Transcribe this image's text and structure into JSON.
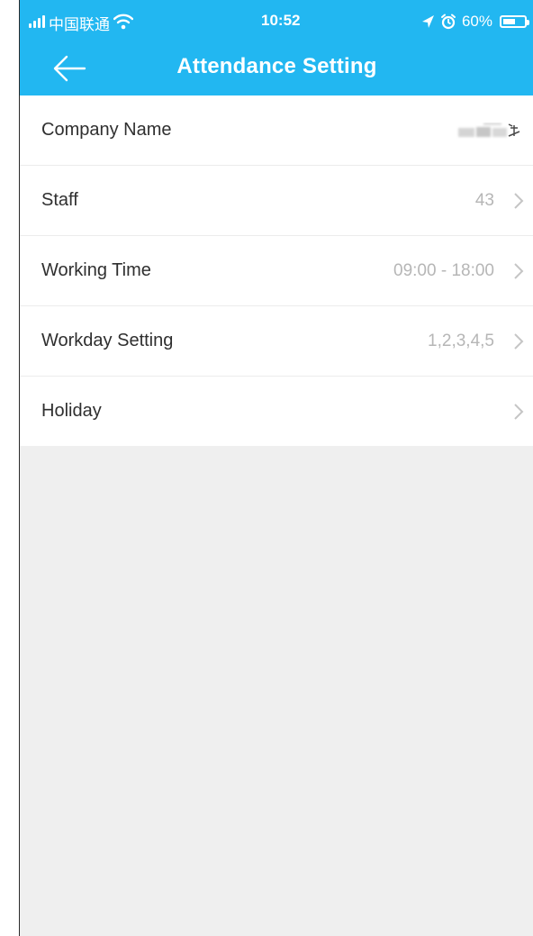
{
  "status_bar": {
    "carrier": "中国联通",
    "time": "10:52",
    "battery_percent": "60%",
    "battery_level": 0.6,
    "icons": [
      "signal-bars-icon",
      "wifi-icon",
      "location-arrow-icon",
      "alarm-clock-icon",
      "battery-icon"
    ]
  },
  "header": {
    "title": "Attendance Setting",
    "back_icon": "arrow-left-icon",
    "background": "#22b7f1"
  },
  "settings": [
    {
      "label": "Company Name",
      "value": ""
    },
    {
      "label": "Staff",
      "value": "43"
    },
    {
      "label": "Working Time",
      "value": "09:00 - 18:00"
    },
    {
      "label": "Workday Setting",
      "value": "1,2,3,4,5"
    },
    {
      "label": "Holiday",
      "value": ""
    }
  ],
  "colors": {
    "accent": "#22b7f1",
    "page_background": "#efefef",
    "value_text": "#b6b6b6"
  }
}
